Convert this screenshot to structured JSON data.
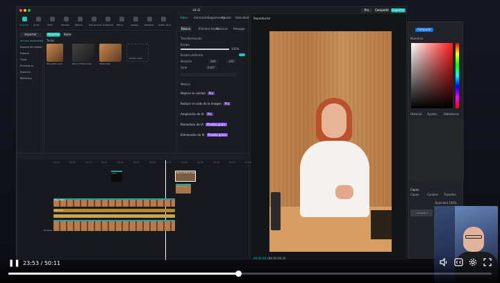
{
  "menu_clock": "18:32",
  "topbar": {
    "pro_label": "Pro",
    "compare_label": "Compartir",
    "export_label": "Exportar"
  },
  "toolbar": [
    "Importar",
    "Audio",
    "Texto",
    "Stickers",
    "Efectos",
    "Transiciones",
    "Subtitulos",
    "Filtros",
    "Ajustes",
    "Plantillas",
    "Avatar de IA"
  ],
  "media": {
    "import_label": "Importar",
    "tab_label": "Nube",
    "section": "Todos",
    "sidebar": [
      "Archivo multimedia",
      "Espacio de trabajo",
      "Espacio",
      "Tuyos",
      "Archivos ac",
      "Espacios",
      "Biblioteca"
    ],
    "files": [
      "IMG_0001.mp4",
      "Mirror FHS1H.mp4",
      "IMG3.mp4"
    ],
    "placeholder": "Añadir video"
  },
  "inspector": {
    "tabs": [
      "Video",
      "Animación",
      "Seguimiento",
      "Ajustar",
      "Velocidad"
    ],
    "subtabs": [
      "Básico",
      "Eliminar fondo",
      "Máscara",
      "Retoque"
    ],
    "transform": "Transformación",
    "scale": "Escala",
    "scale_value": "100%",
    "uniform": "Escala uniforme",
    "position": "Posición",
    "pos_x": "300",
    "pos_y": "100",
    "rotate": "Girar",
    "rotate_value": "0.00°",
    "mezcla": "Mezcla",
    "features": [
      "Mejorar la calidad",
      "Reducir el ruido de la imagen",
      "Ampliación de IA",
      "Remastear de IA",
      "Eliminación de IA"
    ],
    "pro_tag": "Pro",
    "badge": "Prueba gratis"
  },
  "player": {
    "title": "Reproductor",
    "time_current": "00:00:28:15",
    "time_total": "00:04:08:30"
  },
  "timeline": {
    "ruler": [
      "00:00",
      "00:05",
      "00:10",
      "00:15",
      "00:20",
      "00:25",
      "00:30",
      "00:35",
      "00:40",
      "00:45",
      "00:50",
      "00:55",
      "01:00"
    ],
    "clips": [
      "Intro",
      "Mirror FHS1H.mp4",
      "IMG_0001",
      "IMG3.mp4",
      "Voz.mp3"
    ],
    "cover_label": "Portada"
  },
  "ps": {
    "export_label": "Compartir",
    "swatch_tab": "Muestras",
    "props_tabs": [
      "Historial",
      "Ajustes",
      "Bibliotecas"
    ],
    "layers_title": "Capas",
    "layers_tabs": [
      "Capas",
      "Canales",
      "Trazados"
    ],
    "layer_name": "Consulta 1",
    "opacity_label": "Opacidad 100%"
  },
  "playback": {
    "time_current": "23:53",
    "time_total": "50:11",
    "progress": 0.476
  },
  "colors": {
    "accent": "#1ec7c0",
    "brand": "#1aa6a2",
    "pro": "#8b55ff"
  },
  "icons": [
    "play-pause-icon",
    "volume-icon",
    "captions-icon",
    "settings-icon",
    "fullscreen-icon"
  ]
}
